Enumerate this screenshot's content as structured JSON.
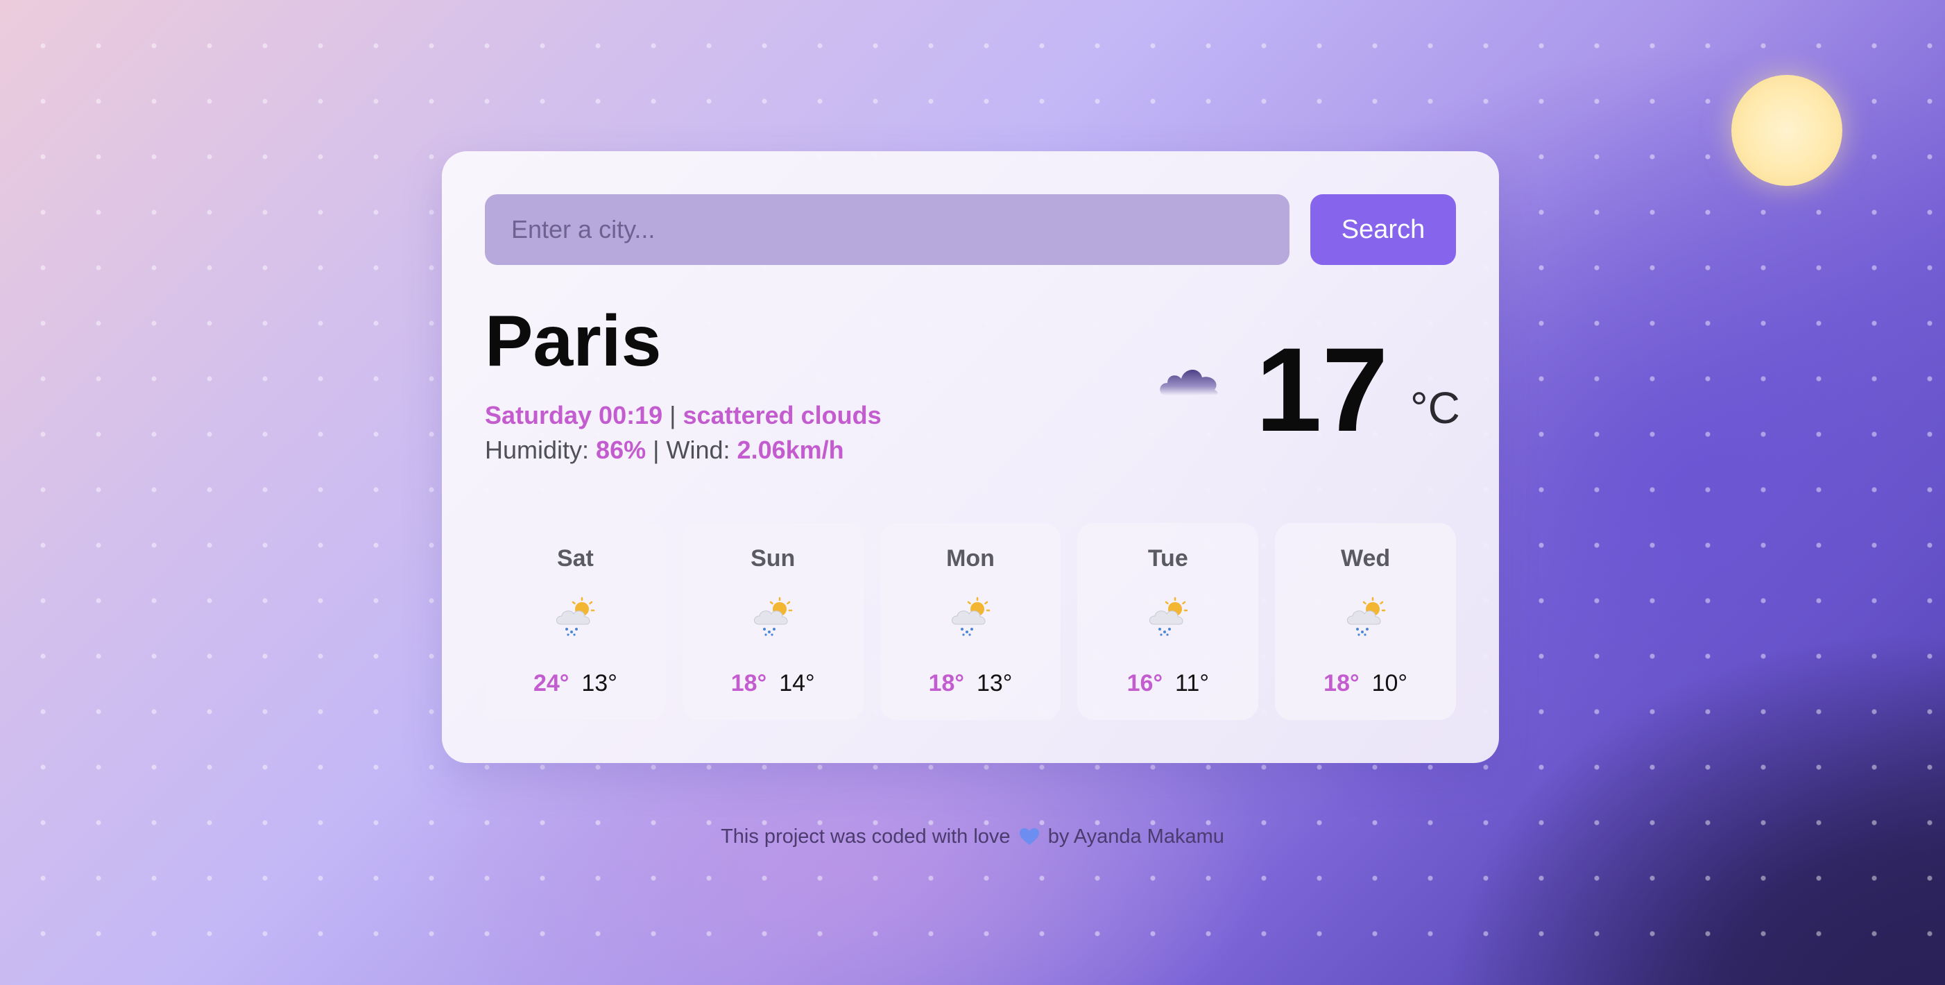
{
  "search": {
    "placeholder": "Enter a city...",
    "value": "",
    "button_label": "Search"
  },
  "current": {
    "city": "Paris",
    "datetime": "Saturday 00:19",
    "separator": "|",
    "description": "scattered clouds",
    "humidity_label": "Humidity:",
    "humidity_value": "86%",
    "wind_label": "Wind:",
    "wind_value": "2.06km/h",
    "icon": "cloud-icon",
    "temperature": "17",
    "unit": "°C"
  },
  "forecast": [
    {
      "day": "Sat",
      "icon": "rain-sun-cloud-icon",
      "max": "24°",
      "min": "13°"
    },
    {
      "day": "Sun",
      "icon": "rain-sun-cloud-icon",
      "max": "18°",
      "min": "14°"
    },
    {
      "day": "Mon",
      "icon": "rain-sun-cloud-icon",
      "max": "18°",
      "min": "13°"
    },
    {
      "day": "Tue",
      "icon": "rain-sun-cloud-icon",
      "max": "16°",
      "min": "11°"
    },
    {
      "day": "Wed",
      "icon": "rain-sun-cloud-icon",
      "max": "18°",
      "min": "10°"
    }
  ],
  "footer": {
    "prefix": "This project was coded with love",
    "icon": "blue-heart-icon",
    "suffix": "by Ayanda Makamu"
  },
  "colors": {
    "accent": "#c35ccf",
    "button": "#8665ec",
    "input": "#b7a9db"
  }
}
